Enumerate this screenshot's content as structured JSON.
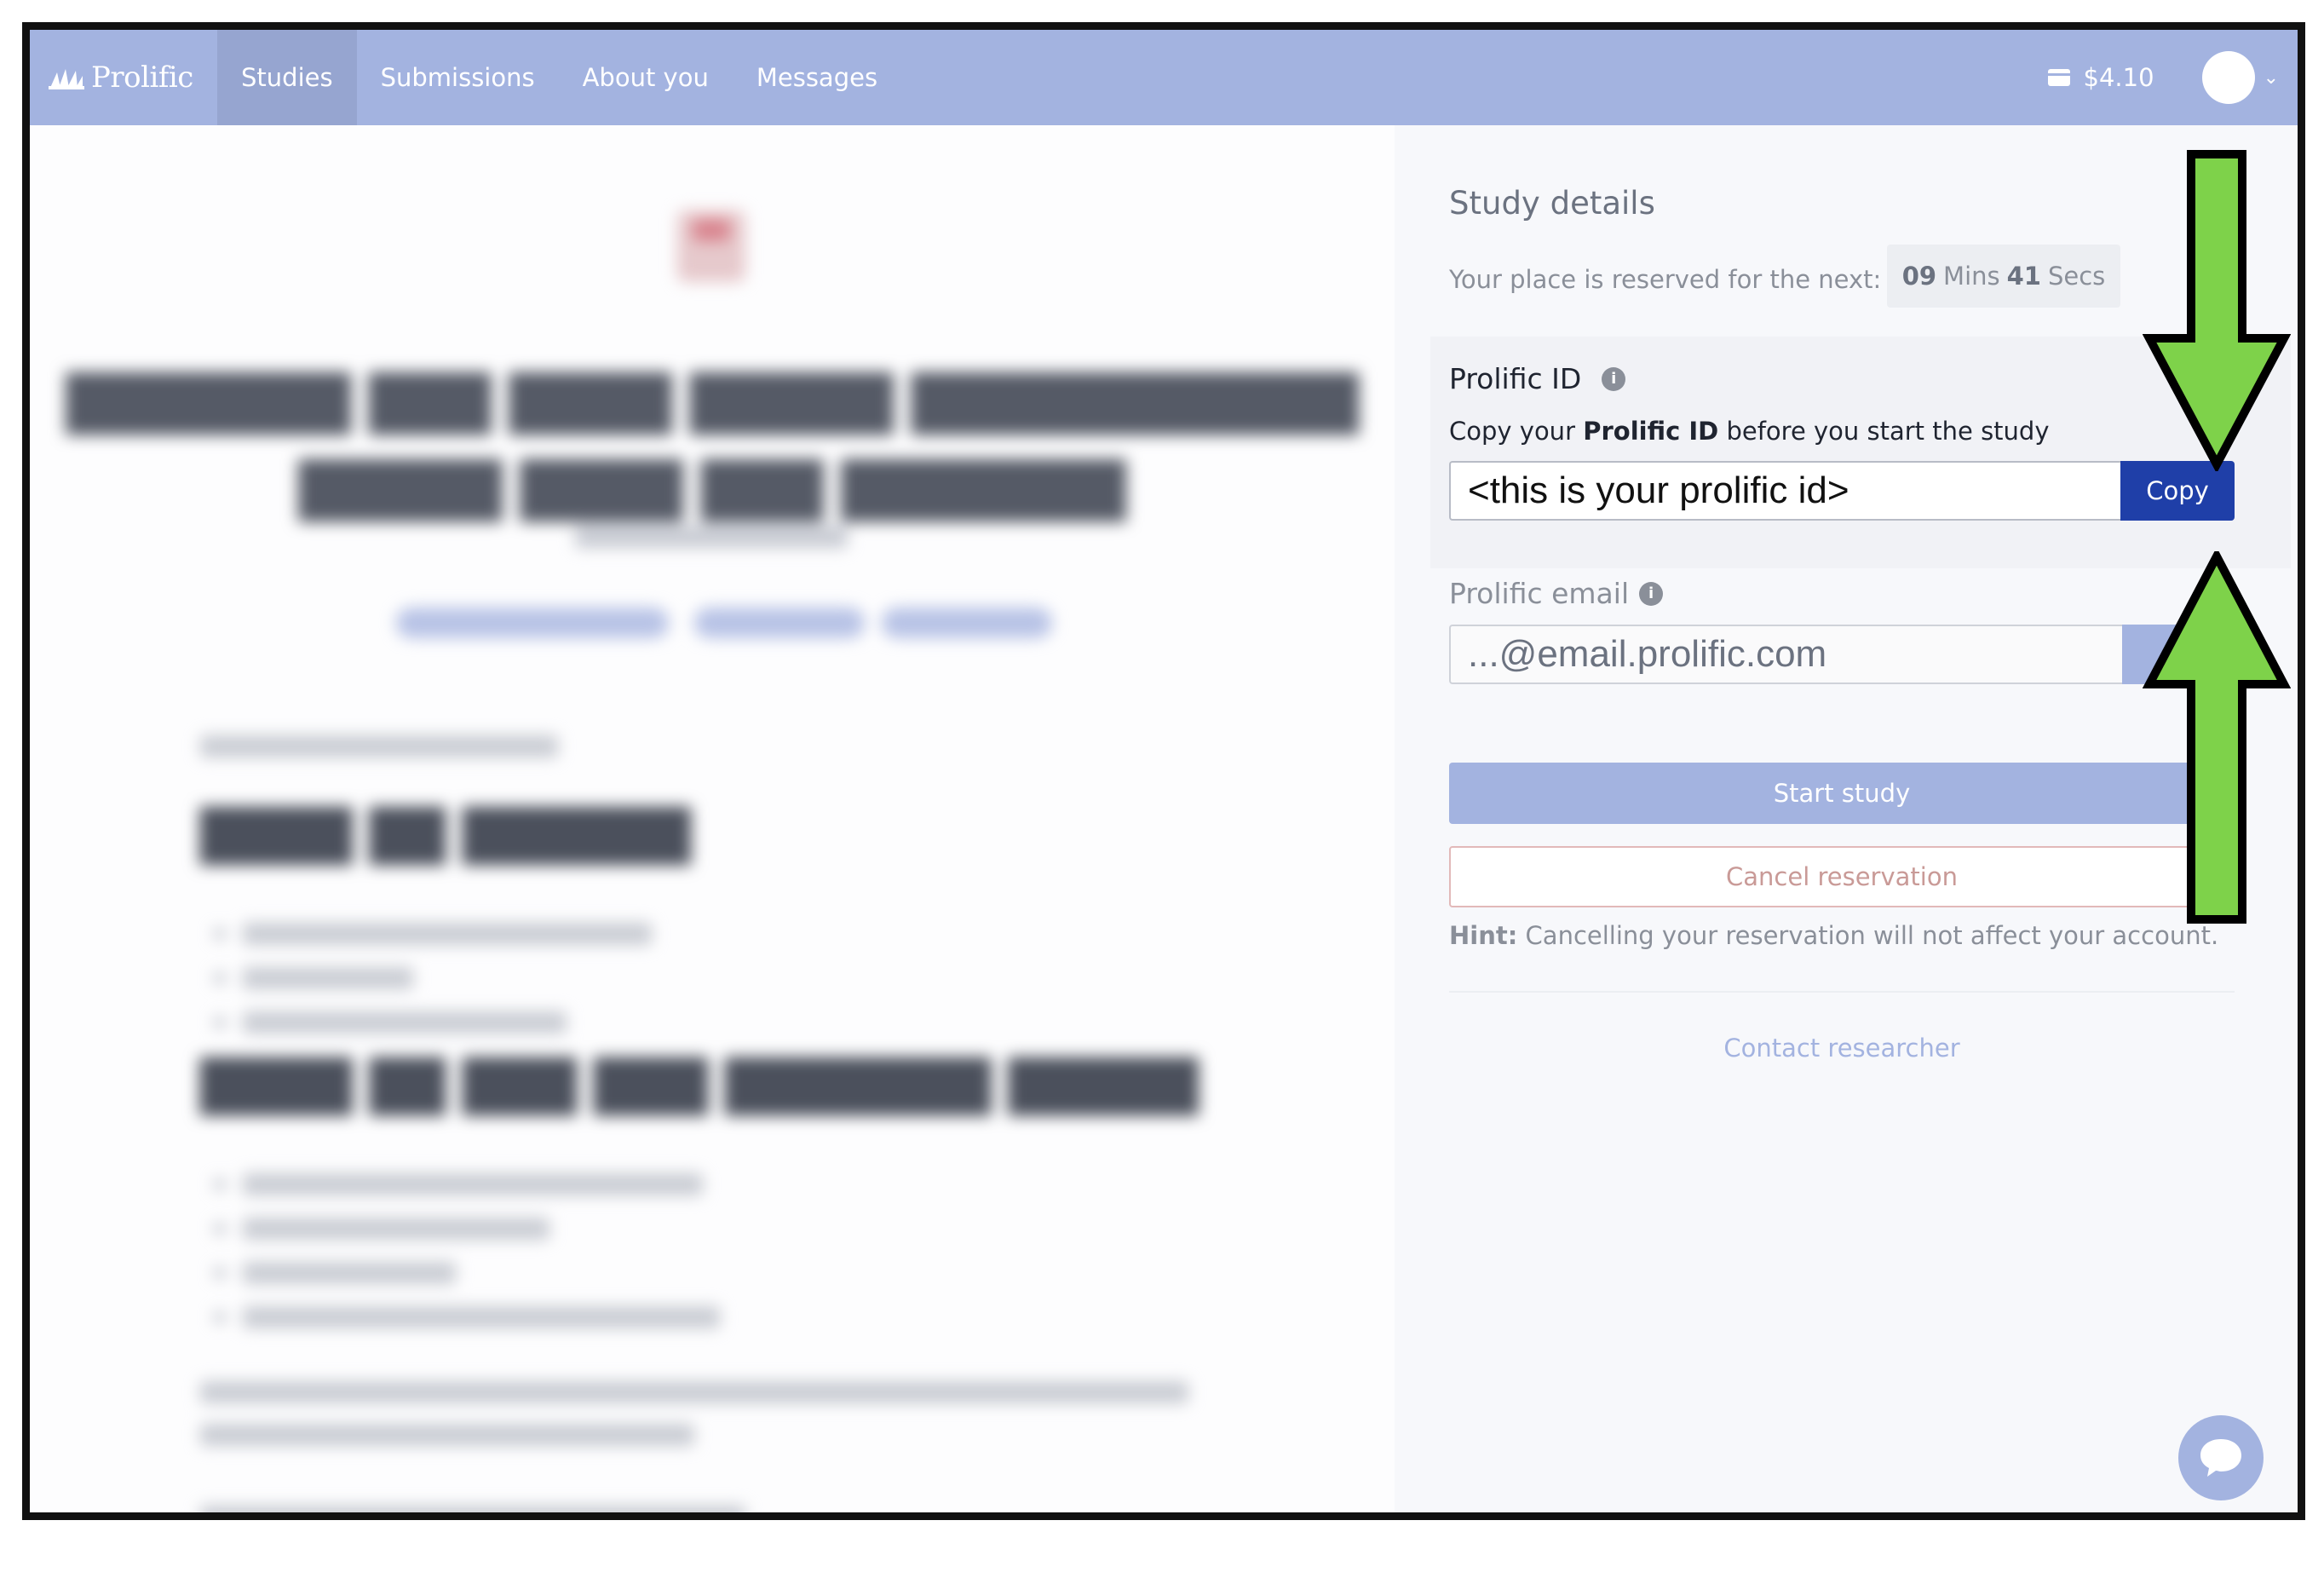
{
  "nav": {
    "brand": "Prolific",
    "tabs": [
      "Studies",
      "Submissions",
      "About you",
      "Messages"
    ],
    "active_tab": "Studies",
    "balance": "$4.10"
  },
  "study": {
    "details_title": "Study details",
    "reserved_label": "Your place is reserved for the next:",
    "timer_minutes": "09",
    "timer_minutes_unit": "Mins",
    "timer_seconds": "41",
    "timer_seconds_unit": "Secs"
  },
  "prolific_id": {
    "label": "Prolific ID",
    "copy_prefix": "Copy your",
    "copy_bold": "Prolific ID",
    "copy_suffix": "before you start the study",
    "value": "<this is your prolific id>",
    "copy_button": "Copy"
  },
  "email": {
    "label": "Prolific email",
    "value": "...@email.prolific.com"
  },
  "actions": {
    "start": "Start study",
    "cancel": "Cancel reservation",
    "hint_bold": "Hint:",
    "hint_text": "Cancelling your reservation will not affect your account.",
    "contact": "Contact researcher"
  },
  "colors": {
    "nav": "#a3b3e0",
    "copy_button": "#1f3fa8",
    "arrow_fill": "#7ed24a",
    "arrow_stroke": "#000000"
  },
  "icons": {
    "info": "i"
  }
}
